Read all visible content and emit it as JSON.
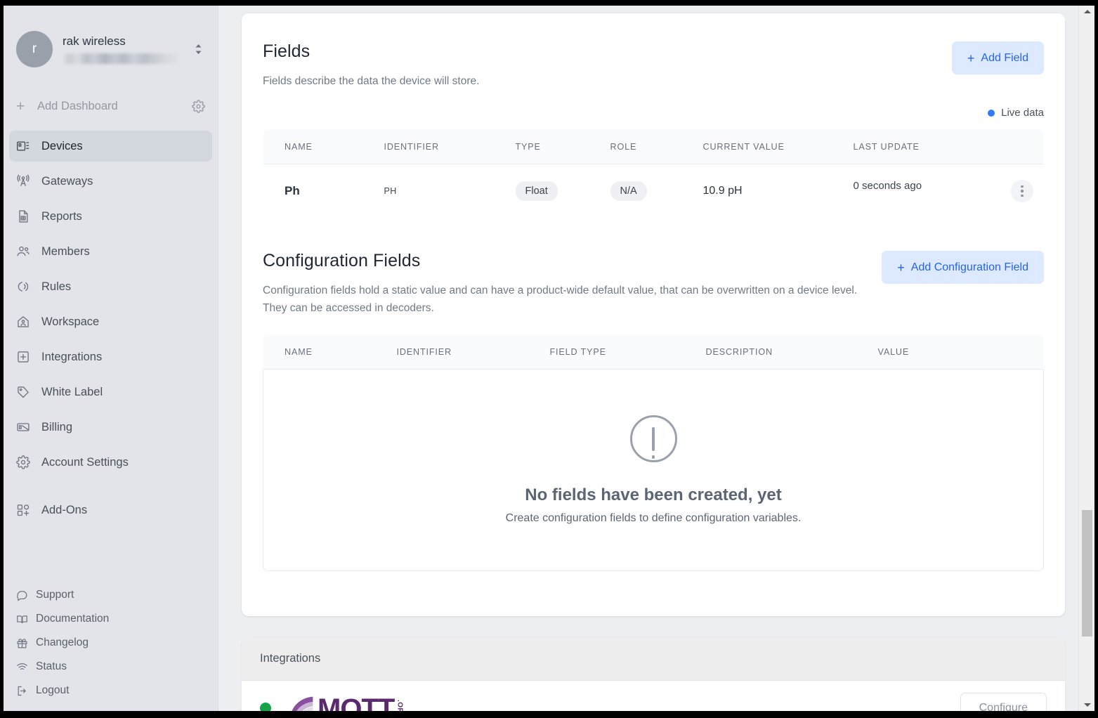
{
  "sidebar": {
    "account": {
      "avatar_initial": "r",
      "name": "rak wireless",
      "email_redacted": true,
      "switch_icon": "chevron-up-down-icon"
    },
    "add_dashboard": {
      "label": "Add Dashboard",
      "plus": "+",
      "settings_icon": "gear-icon"
    },
    "nav_items": [
      {
        "label": "Devices",
        "icon": "devices-icon",
        "active": true
      },
      {
        "label": "Gateways",
        "icon": "antenna-icon",
        "active": false
      },
      {
        "label": "Reports",
        "icon": "report-document-icon",
        "active": false
      },
      {
        "label": "Members",
        "icon": "users-icon",
        "active": false
      },
      {
        "label": "Rules",
        "icon": "rules-broadcast-icon",
        "active": false
      },
      {
        "label": "Workspace",
        "icon": "home-icon",
        "active": false
      },
      {
        "label": "Integrations",
        "icon": "plus-square-icon",
        "active": false
      },
      {
        "label": "White Label",
        "icon": "tag-icon",
        "active": false
      },
      {
        "label": "Billing",
        "icon": "invoice-icon",
        "active": false
      },
      {
        "label": "Account Settings",
        "icon": "gear-icon",
        "active": false
      },
      {
        "label": "Add-Ons",
        "icon": "add-ons-icon",
        "active": false
      }
    ],
    "footer_items": [
      {
        "label": "Support",
        "icon": "chat-bubble-icon"
      },
      {
        "label": "Documentation",
        "icon": "book-icon"
      },
      {
        "label": "Changelog",
        "icon": "gift-icon"
      },
      {
        "label": "Status",
        "icon": "wifi-icon"
      },
      {
        "label": "Logout",
        "icon": "logout-icon"
      }
    ]
  },
  "fields_section": {
    "title": "Fields",
    "description": "Fields describe the data the device will store.",
    "add_button": "Add Field",
    "add_button_plus": "+",
    "live_data_label": "Live data",
    "live_data_color": "#2f7cf6",
    "columns": [
      "NAME",
      "IDENTIFIER",
      "TYPE",
      "ROLE",
      "CURRENT VALUE",
      "LAST UPDATE"
    ],
    "rows": [
      {
        "name": "Ph",
        "identifier": "PH",
        "type": "Float",
        "role": "N/A",
        "current_value": "10.9 pH",
        "last_update": "0 seconds ago",
        "menu_icon": "kebab-menu-icon"
      }
    ]
  },
  "config_fields_section": {
    "title": "Configuration Fields",
    "description": "Configuration fields hold a static value and can have a product-wide default value, that can be overwritten on a device level. They can be accessed in decoders.",
    "add_button": "Add Configuration Field",
    "add_button_plus": "+",
    "columns": [
      "NAME",
      "IDENTIFIER",
      "FIELD TYPE",
      "DESCRIPTION",
      "VALUE"
    ],
    "empty_state": {
      "icon": "exclamation-circle-icon",
      "title": "No fields have been created, yet",
      "subtitle": "Create configuration fields to define configuration variables."
    }
  },
  "integrations_section": {
    "title": "Integrations",
    "rows": [
      {
        "status": "connected",
        "status_color": "#16a34a",
        "logo_text": "MQTT",
        "logo_suffix": ".ORG",
        "logo_color": "#5b2a6e",
        "action_label": "Configure"
      }
    ]
  },
  "scrollbar": {
    "up_arrow": "triangle-up-icon",
    "down_arrow": "triangle-down-icon"
  }
}
